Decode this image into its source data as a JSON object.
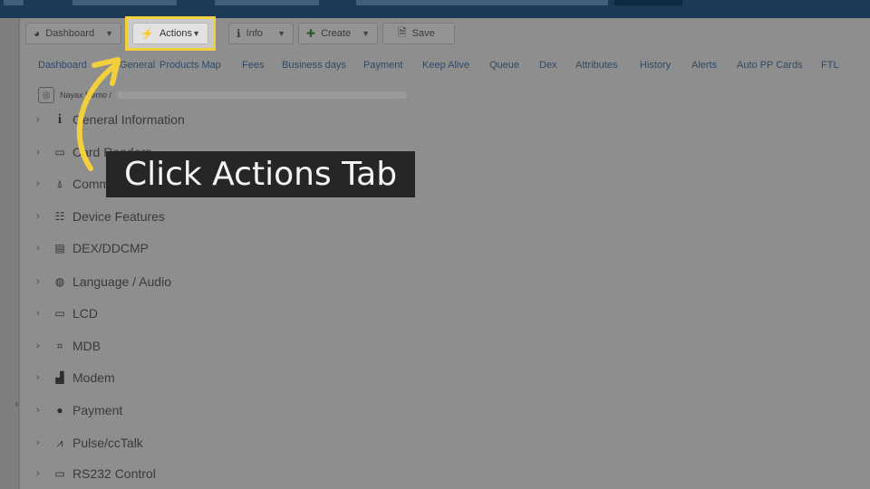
{
  "toolbar": {
    "dashboard_label": "Dashboard",
    "actions_label": "Actions",
    "info_label": "Info",
    "create_label": "Create",
    "save_label": "Save"
  },
  "tabs": [
    "Dashboard",
    "General",
    "Products Map",
    "Fees",
    "Business days",
    "Payment",
    "Keep Alive",
    "Queue",
    "Dex",
    "Attributes",
    "History",
    "Alerts",
    "Auto PP Cards",
    "FTL"
  ],
  "breadcrumb": {
    "root": "Nayax Demo /"
  },
  "tree": [
    {
      "label": "General Information",
      "icon": "info-icon"
    },
    {
      "label": "Card Readers",
      "icon": "card-reader-icon"
    },
    {
      "label": "Communication",
      "icon": "antenna-icon"
    },
    {
      "label": "Device Features",
      "icon": "features-icon"
    },
    {
      "label": "DEX/DDCMP",
      "icon": "dex-icon"
    },
    {
      "label": "Language / Audio",
      "icon": "globe-icon"
    },
    {
      "label": "LCD",
      "icon": "lcd-icon"
    },
    {
      "label": "MDB",
      "icon": "mdb-icon"
    },
    {
      "label": "Modem",
      "icon": "modem-icon"
    },
    {
      "label": "Payment",
      "icon": "payment-icon"
    },
    {
      "label": "Pulse/ccTalk",
      "icon": "pulse-icon"
    },
    {
      "label": "RS232 Control",
      "icon": "rs232-icon"
    }
  ],
  "overlay": {
    "text": "Click Actions Tab"
  },
  "colors": {
    "highlight": "#f2cf3c",
    "overlay_bg": "#262626",
    "topbar": "#1a3a55"
  }
}
